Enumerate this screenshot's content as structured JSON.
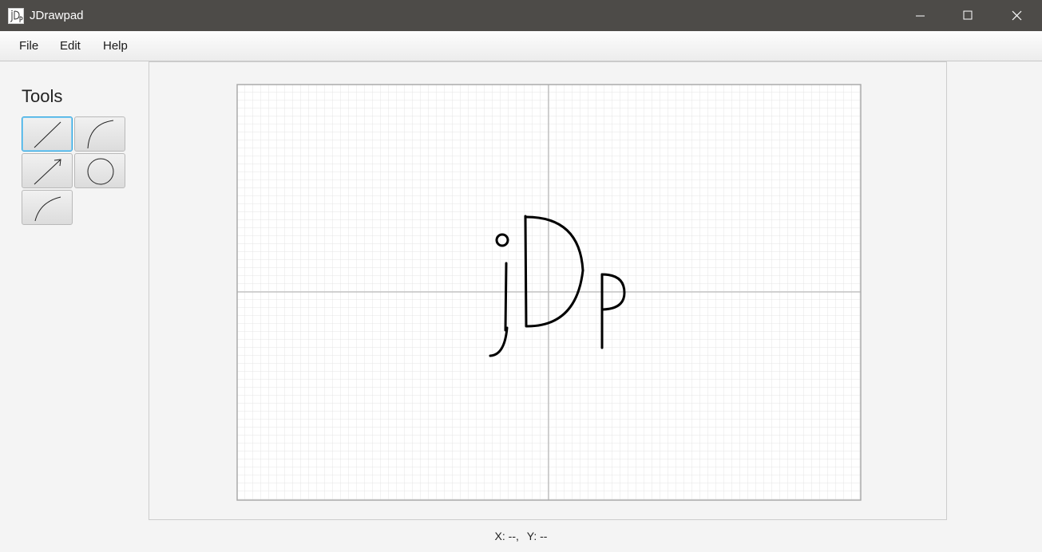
{
  "window": {
    "title": "JDrawpad",
    "app_icon": "jdrawpad-logo-icon",
    "controls": [
      "minimize-icon",
      "maximize-icon",
      "close-icon"
    ]
  },
  "menu": {
    "items": [
      {
        "label": "File"
      },
      {
        "label": "Edit"
      },
      {
        "label": "Help"
      }
    ]
  },
  "tools": {
    "title": "Tools",
    "items": [
      {
        "name": "line-tool",
        "icon": "line-icon",
        "selected": true
      },
      {
        "name": "arc-tool",
        "icon": "arc-icon",
        "selected": false
      },
      {
        "name": "arrow-tool",
        "icon": "arrow-icon",
        "selected": false
      },
      {
        "name": "circle-tool",
        "icon": "circle-icon",
        "selected": false
      },
      {
        "name": "curve-tool",
        "icon": "curve-icon",
        "selected": false
      }
    ]
  },
  "canvas": {
    "grid": true,
    "background": "#ffffff",
    "grid_color": "#e4e4e4",
    "axis_color": "#bdbdbd",
    "stroke_color": "#000000"
  },
  "status": {
    "x": "X: --,",
    "y": "Y: --"
  },
  "colors": {
    "titlebar": "#4d4b48",
    "selected_border": "#2aa4e0"
  }
}
